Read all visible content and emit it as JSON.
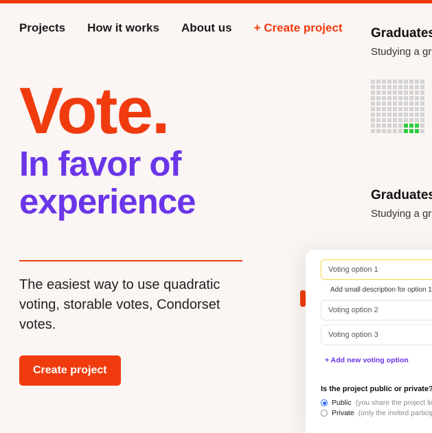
{
  "nav": {
    "projects": "Projects",
    "how": "How it works",
    "about": "About us",
    "create": "+ Create project"
  },
  "hero": {
    "vote": "Vote.",
    "favor": "In favor of experience",
    "sub": "The easiest way to use quadratic voting, storable votes, Condorset votes.",
    "cta": "Create project"
  },
  "cards": [
    {
      "title": "Graduates",
      "sub": "Studying a gra"
    },
    {
      "title": "Graduates",
      "sub": "Studying a gra"
    }
  ],
  "form": {
    "opt1": "Voting option 1",
    "opt1_desc": "Add small description for option 1",
    "opt2": "Voting option 2",
    "opt3": "Voting option 3",
    "add": "+ Add new voting option",
    "question": "Is the project public or private?",
    "public_label": "Public",
    "public_hint": "(you share the project link and th",
    "private_label": "Private",
    "private_hint": "(only the invited participants ca"
  }
}
